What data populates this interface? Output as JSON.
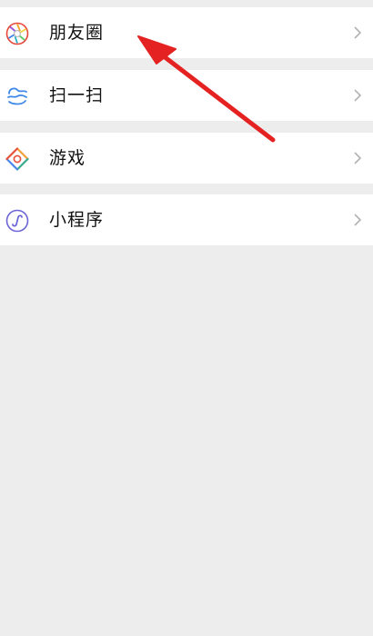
{
  "discover_menu": {
    "items": [
      {
        "label": "朋友圈",
        "icon": "moments-aperture-icon"
      },
      {
        "label": "扫一扫",
        "icon": "scan-icon"
      },
      {
        "label": "游戏",
        "icon": "games-icon"
      },
      {
        "label": "小程序",
        "icon": "mini-programs-icon"
      }
    ]
  },
  "colors": {
    "background": "#ededed",
    "row_background": "#ffffff",
    "text": "#111111",
    "chevron": "#b2b2b2",
    "annotation_arrow": "#e52222",
    "scan_icon": "#3f88e8",
    "mini_program_icon": "#6a64d6"
  },
  "annotation": {
    "type": "arrow",
    "points_to": "朋友圈"
  }
}
